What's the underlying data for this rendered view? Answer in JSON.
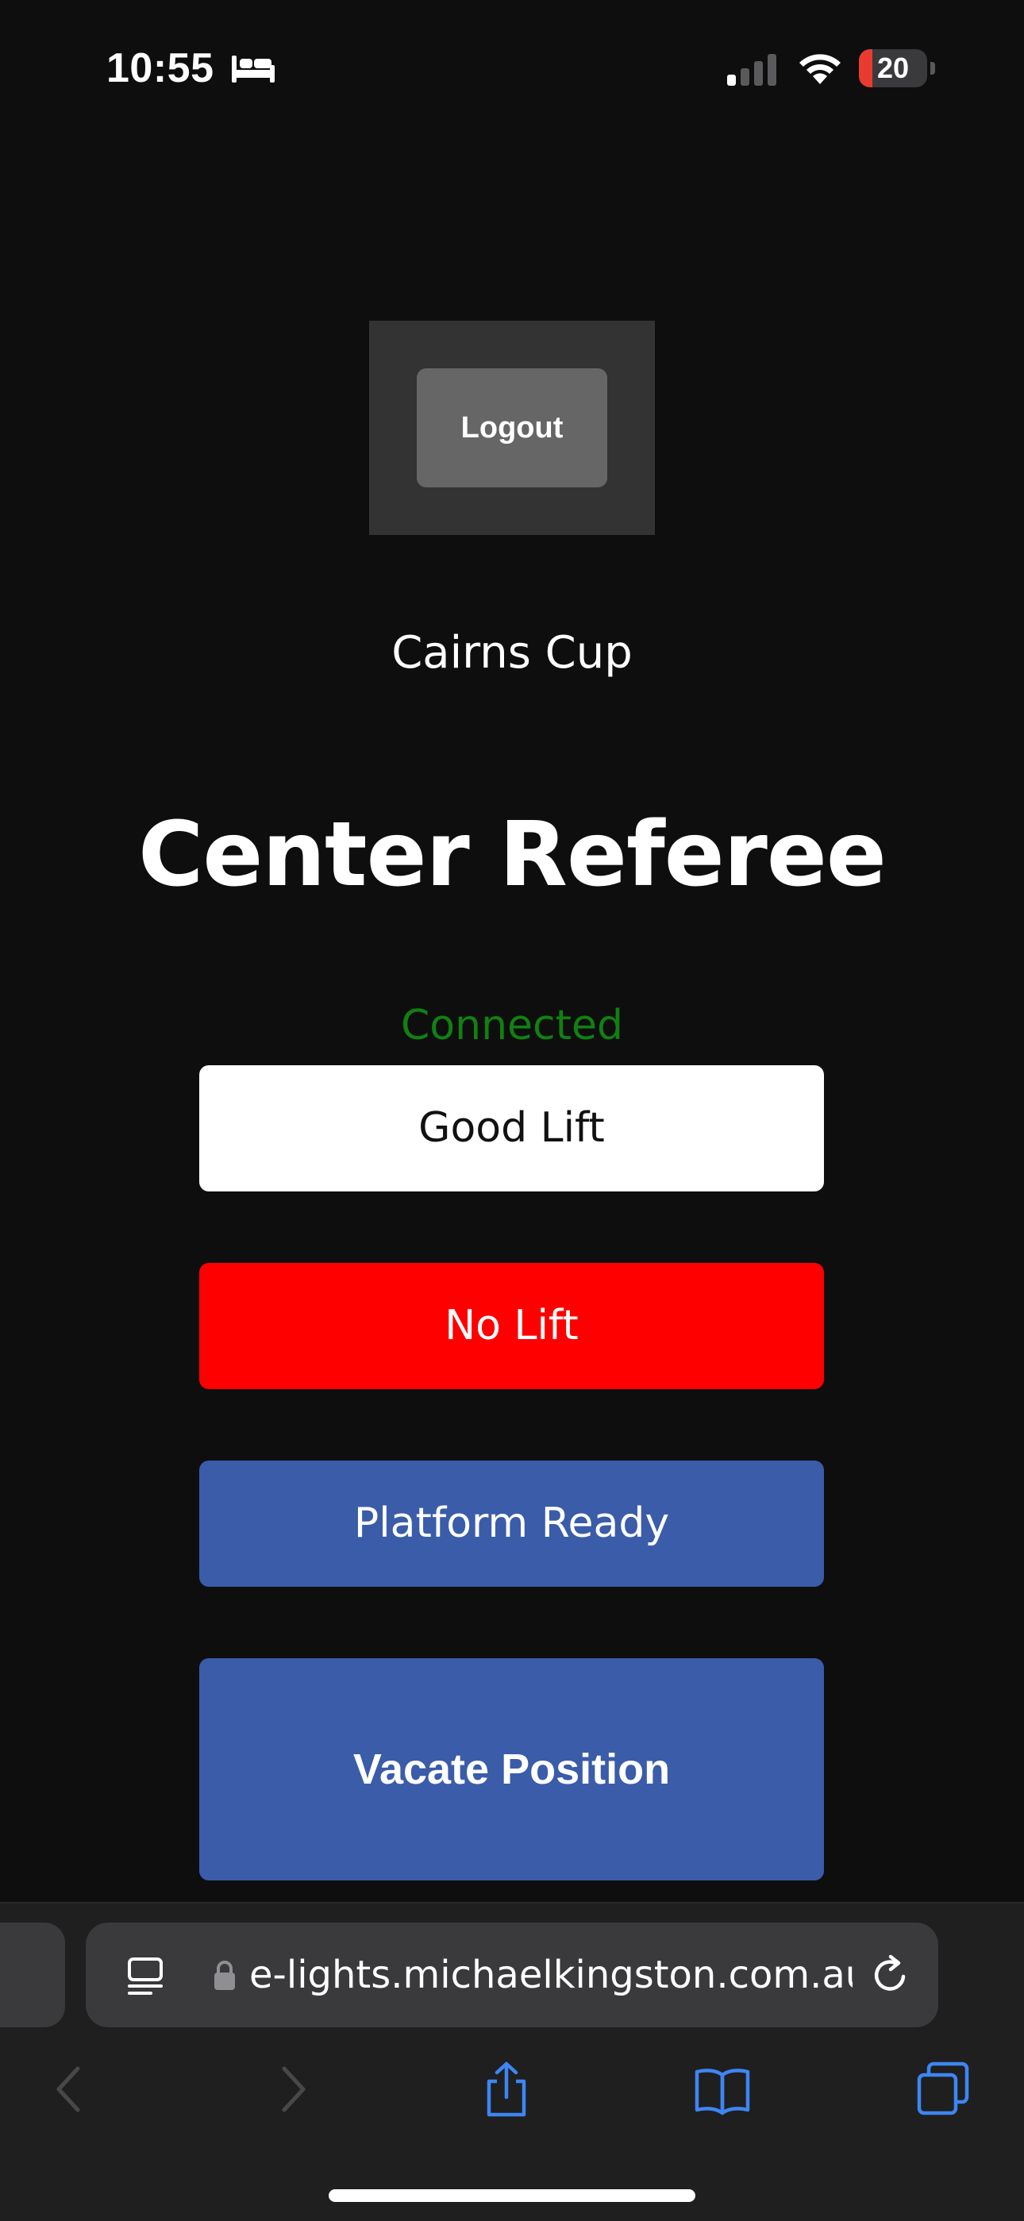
{
  "status_bar": {
    "time": "10:55",
    "battery_level": "20",
    "battery_fraction": 0.2,
    "icons": [
      "bed-icon",
      "cellular-signal-icon",
      "wifi-icon",
      "battery-icon"
    ],
    "battery_color": "#ea3b30"
  },
  "page": {
    "logout_label": "Logout",
    "event_name": "Cairns Cup",
    "title": "Center Referee",
    "connection_status": "Connected",
    "connection_color": "#118011"
  },
  "actions": {
    "good_lift": "Good Lift",
    "no_lift": "No Lift",
    "platform_ready": "Platform Ready",
    "vacate_position": "Vacate Position"
  },
  "colors": {
    "background": "#0e0e0f",
    "good_lift": "#ffffff",
    "no_lift": "#ff0000",
    "primary_blue": "#3a5ca9",
    "logout_frame": "#333333",
    "logout_button": "#666666"
  },
  "browser": {
    "url": "e-lights.michaelkingston.com.au",
    "toolbar_icons": [
      "back-icon",
      "forward-icon",
      "share-icon",
      "bookmarks-icon",
      "tabs-icon"
    ],
    "address_icons": [
      "reader-icon",
      "lock-icon",
      "reload-icon"
    ]
  }
}
